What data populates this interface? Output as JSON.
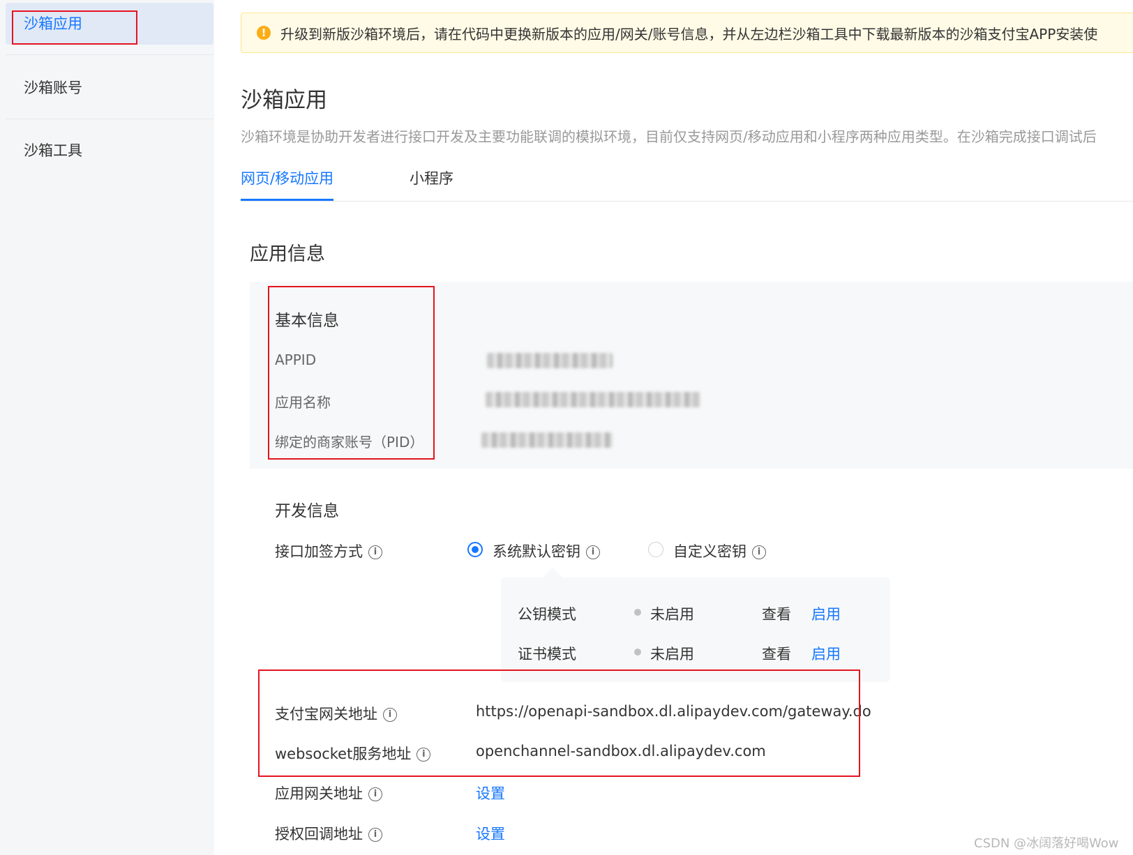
{
  "sidebar": {
    "items": [
      {
        "label": "沙箱应用",
        "active": true
      },
      {
        "label": "沙箱账号",
        "active": false
      },
      {
        "label": "沙箱工具",
        "active": false
      }
    ]
  },
  "notice": {
    "icon": "warning-icon",
    "text": "升级到新版沙箱环境后，请在代码中更换新版本的应用/网关/账号信息，并从左边栏沙箱工具中下载最新版本的沙箱支付宝APP安装使"
  },
  "page": {
    "title": "沙箱应用",
    "description": "沙箱环境是协助开发者进行接口开发及主要功能联调的模拟环境，目前仅支持网页/移动应用和小程序两种应用类型。在沙箱完成接口调试后"
  },
  "tabs": [
    {
      "label": "网页/移动应用",
      "active": true
    },
    {
      "label": "小程序",
      "active": false
    }
  ],
  "app_info": {
    "title": "应用信息",
    "basic": {
      "title": "基本信息",
      "rows": [
        {
          "label": "APPID"
        },
        {
          "label": "应用名称"
        },
        {
          "label": "绑定的商家账号（PID）"
        }
      ]
    },
    "dev": {
      "title": "开发信息",
      "sign_method_label": "接口加签方式",
      "options": [
        {
          "label": "系统默认密钥",
          "checked": true
        },
        {
          "label": "自定义密钥",
          "checked": false
        }
      ],
      "modes": [
        {
          "label": "公钥模式",
          "status": "未启用",
          "view": "查看",
          "enable": "启用"
        },
        {
          "label": "证书模式",
          "status": "未启用",
          "view": "查看",
          "enable": "启用"
        }
      ],
      "gateway_label": "支付宝网关地址",
      "gateway_value": "https://openapi-sandbox.dl.alipaydev.com/gateway.do",
      "websocket_label": "websocket服务地址",
      "websocket_value": "openchannel-sandbox.dl.alipaydev.com",
      "app_gateway_label": "应用网关地址",
      "app_gateway_action": "设置",
      "callback_label": "授权回调地址",
      "callback_action": "设置"
    }
  },
  "watermark": "CSDN @冰阔落好喝Wow",
  "colors": {
    "accent": "#1677ff",
    "annotation": "#e4141f",
    "notice_bg": "#fffbe6"
  }
}
